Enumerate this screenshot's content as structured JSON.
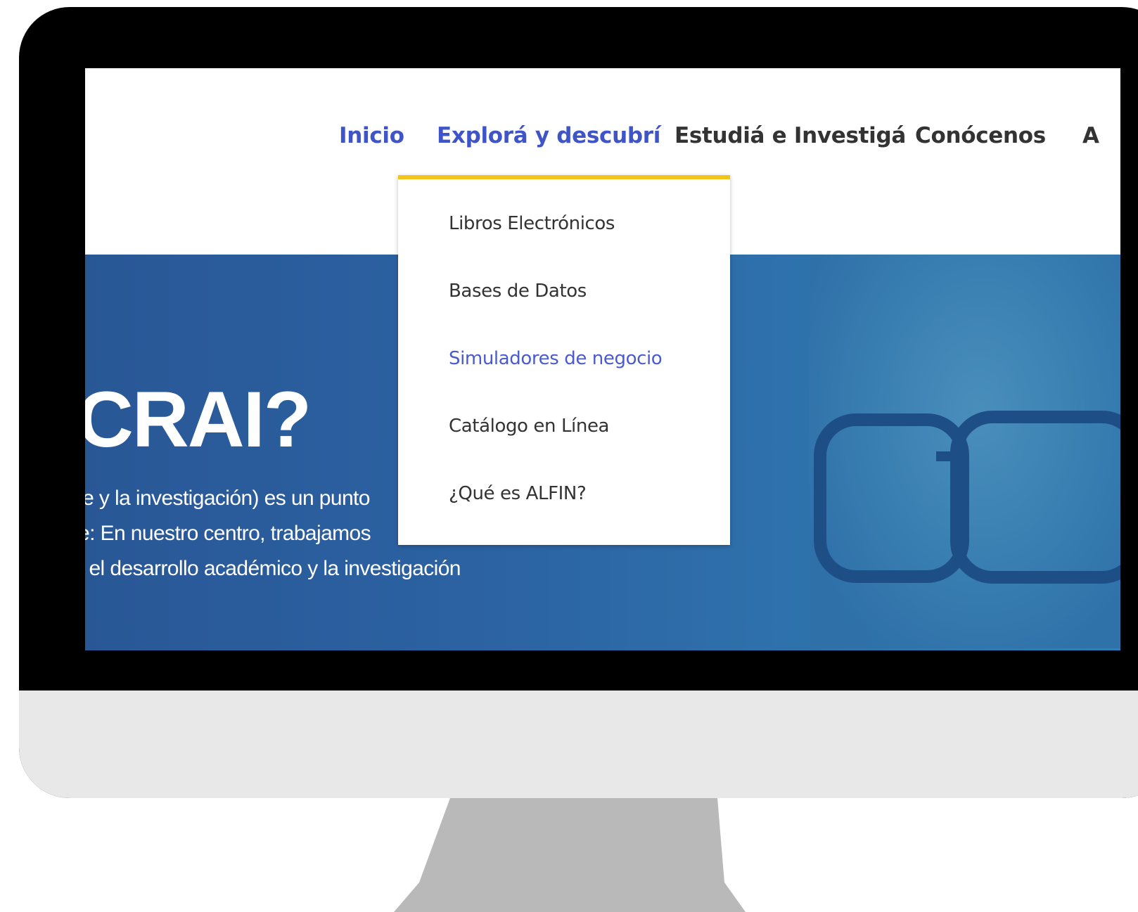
{
  "nav": {
    "items": [
      {
        "label": "Inicio",
        "active": true
      },
      {
        "label": "Explorá y descubrí",
        "active": true
      },
      {
        "label": "Estudiá e Investigá",
        "active": false
      },
      {
        "label": "Conócenos",
        "active": false
      },
      {
        "label": "A",
        "active": false
      }
    ]
  },
  "dropdown": {
    "accent_color": "#f0c419",
    "items": [
      {
        "label": "Libros Electrónicos"
      },
      {
        "label": "Bases de Datos"
      },
      {
        "label": "Simuladores de negocio",
        "highlighted": true
      },
      {
        "label": "Catálogo en Línea"
      },
      {
        "label": "¿Qué es ALFIN?"
      }
    ]
  },
  "hero": {
    "title": "CRAI?",
    "lines": [
      "je y la investigación) es un punto",
      "e: En nuestro centro, trabajamos",
      ": el desarrollo académico y la investigación"
    ]
  },
  "colors": {
    "nav_active": "#3f55c7",
    "nav_default": "#333333",
    "hero_blue": "#2c63a3"
  }
}
